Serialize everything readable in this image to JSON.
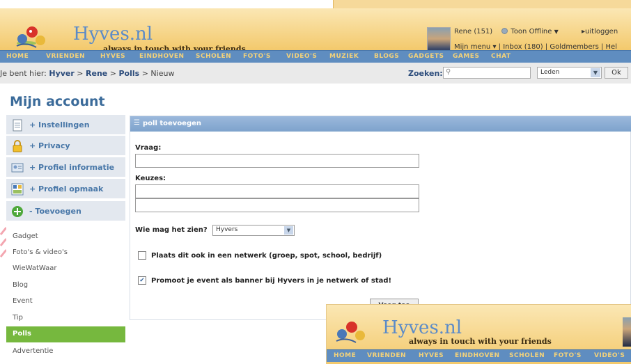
{
  "brand": {
    "name": "Hyves.nl",
    "tagline": "always in touch with your friends"
  },
  "user": {
    "status_line": "Rene (151)",
    "status_button": "Toon Offline",
    "logout": "uitloggen",
    "menu_line": "Mijn menu ▾ | Inbox (180) | Goldmembers | Hel"
  },
  "nav": [
    {
      "label": "HOME"
    },
    {
      "label": "VRIENDEN"
    },
    {
      "label": "HYVES"
    },
    {
      "label": "EINDHOVEN"
    },
    {
      "label": "SCHOLEN"
    },
    {
      "label": "FOTO'S"
    },
    {
      "label": "VIDEO'S"
    },
    {
      "label": "MUZIEK"
    },
    {
      "label": "BLOGS"
    },
    {
      "label": "GADGETS"
    },
    {
      "label": "GAMES"
    },
    {
      "label": "CHAT"
    }
  ],
  "breadcrumb": {
    "prefix": "Je bent hier: ",
    "items": [
      "Hyver",
      "Rene",
      "Polls"
    ],
    "sep": " > ",
    "current": "Nieuw"
  },
  "search": {
    "label": "Zoeken:",
    "scope": "Leden",
    "ok": "Ok"
  },
  "page_title": "Mijn account",
  "sidebar": {
    "sections": [
      {
        "label": "+ Instellingen",
        "icon": "document-icon"
      },
      {
        "label": "+ Privacy",
        "icon": "lock-icon"
      },
      {
        "label": "+ Profiel informatie",
        "icon": "id-card-icon"
      },
      {
        "label": "+ Profiel opmaak",
        "icon": "layout-icon"
      },
      {
        "label": "- Toevoegen",
        "icon": "add-circle-icon"
      }
    ],
    "sub_items": [
      {
        "label": "Gadget"
      },
      {
        "label": "Foto's & video's"
      },
      {
        "label": "WieWatWaar"
      },
      {
        "label": "Blog"
      },
      {
        "label": "Event"
      },
      {
        "label": "Tip"
      },
      {
        "label": "Polls"
      },
      {
        "label": "Advertentie"
      }
    ]
  },
  "form": {
    "header": "poll toevoegen",
    "question_label": "Vraag:",
    "question_value": "",
    "choices_label": "Keuzes:",
    "choice1_value": "",
    "choice2_value": "",
    "visibility_label": "Wie mag het zien?",
    "visibility_value": "Hyvers",
    "network_label": "Plaats dit ook in een netwerk (groep, spot, school, bedrijf)",
    "network_checked": false,
    "promote_label": "Promoot je event als banner bij Hyvers in je netwerk of stad!",
    "promote_checked": true,
    "submit_label": "Voeg toe"
  },
  "overlay_nav": [
    {
      "label": "HOME"
    },
    {
      "label": "VRIENDEN"
    },
    {
      "label": "HYVES"
    },
    {
      "label": "EINDHOVEN"
    },
    {
      "label": "SCHOLEN"
    },
    {
      "label": "FOTO'S"
    },
    {
      "label": "VIDEO'S"
    }
  ],
  "colors": {
    "nav_blue": "#5f8dc0",
    "nav_text": "#f3d27a",
    "header_orange": "#f3c96c",
    "active_green": "#76b83e",
    "link_blue": "#2d4d7c"
  }
}
